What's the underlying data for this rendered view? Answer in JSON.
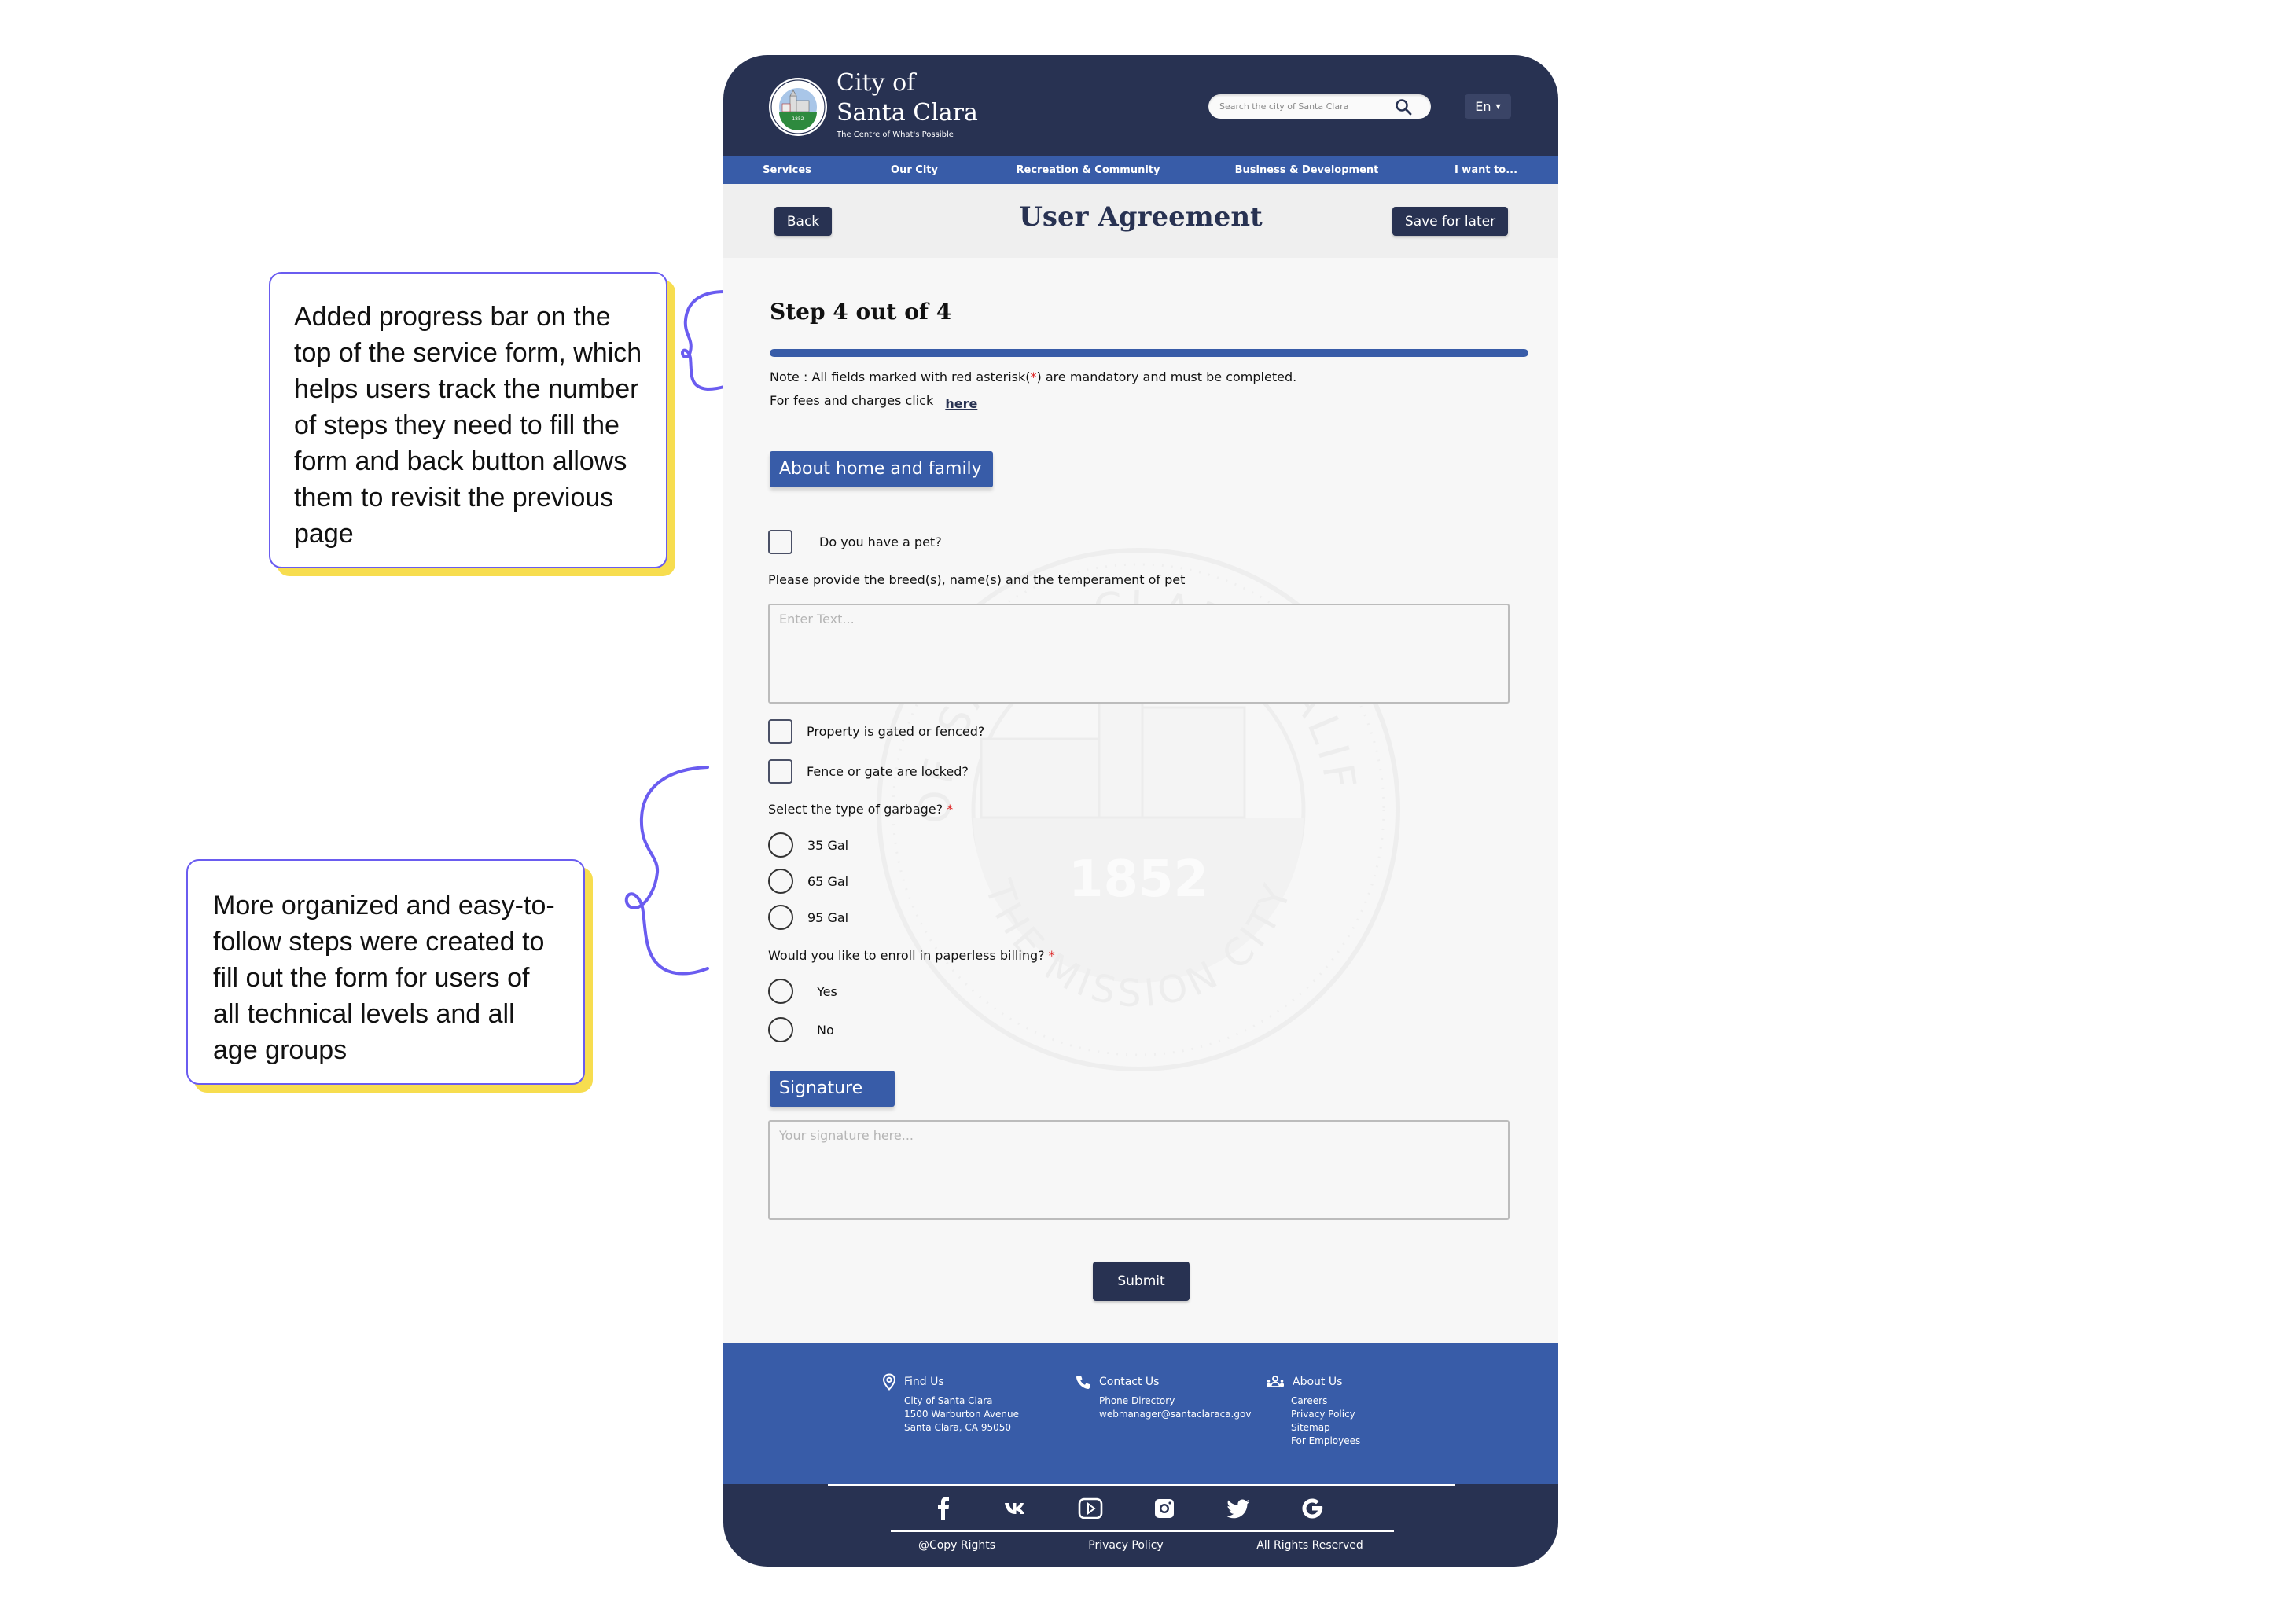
{
  "annotations": [
    {
      "text": "Added progress bar on the top of the service form, which helps users track the number of steps they need to fill the form and back button allows them to revisit the previous page"
    },
    {
      "text": "More organized and easy-to-follow steps were created to fill out the form for users of all technical levels and all age groups"
    }
  ],
  "header": {
    "city_line1": "City of",
    "city_line2": "Santa Clara",
    "tagline": "The Centre of What's Possible",
    "search_placeholder": "Search the city of Santa Clara",
    "language": "En",
    "logo_icon": "city-seal-logo"
  },
  "nav": {
    "items": [
      "Services",
      "Our City",
      "Recreation & Community",
      "Business & Development",
      "I want to..."
    ]
  },
  "title_band": {
    "back_label": "Back",
    "title": "User Agreement",
    "save_label": "Save for later"
  },
  "form": {
    "step_label": "Step 4 out of 4",
    "progress": {
      "current_step": 4,
      "total_steps": 4,
      "percent": 100
    },
    "note_prefix": "Note : All fields marked with red asterisk(",
    "note_asterisk": "*",
    "note_suffix": ") are mandatory and must be completed.",
    "fees_text": "For fees and charges click",
    "fees_link": "here",
    "section_home": "About home and family",
    "pet_question": "Do you have a pet?",
    "pet_details_label": "Please provide the breed(s), name(s) and the temperament of pet",
    "pet_details_placeholder": "Enter Text...",
    "gated_question": "Property is gated or fenced?",
    "locked_question": "Fence or gate are locked?",
    "garbage_question": "Select the type of garbage?",
    "garbage_options": [
      "35 Gal",
      "65 Gal",
      "95 Gal"
    ],
    "paperless_question": "Would you like to enroll in paperless billing?",
    "paperless_options": [
      "Yes",
      "No"
    ],
    "required_mark": "*",
    "section_signature": "Signature",
    "signature_placeholder": "Your signature here...",
    "submit_label": "Submit"
  },
  "footer": {
    "find_us": {
      "title": "Find Us",
      "lines": [
        "City of Santa Clara",
        "1500 Warburton Avenue",
        "Santa Clara, CA 95050"
      ]
    },
    "contact_us": {
      "title": "Contact Us",
      "lines": [
        "Phone Directory",
        "webmanager@santaclaraca.gov"
      ]
    },
    "about_us": {
      "title": "About Us",
      "lines": [
        "Careers",
        "Privacy Policy",
        "Sitemap",
        "For Employees"
      ]
    },
    "social_icons": [
      "facebook-icon",
      "vk-icon",
      "youtube-icon",
      "instagram-icon",
      "twitter-icon",
      "google-icon"
    ],
    "bottom_links": [
      "@Copy Rights",
      "Privacy Policy",
      "All Rights Reserved"
    ]
  },
  "watermark": {
    "top_text": "CITY OF SANTA CLARA CALIFORNIA",
    "bottom_text": "THE MISSION CITY",
    "year": "1852"
  },
  "colors": {
    "navy": "#283252",
    "blue": "#385ca8",
    "accent_purple": "#6a5cf0",
    "highlight_yellow": "#f7dd4f",
    "required_red": "#dd2222"
  }
}
